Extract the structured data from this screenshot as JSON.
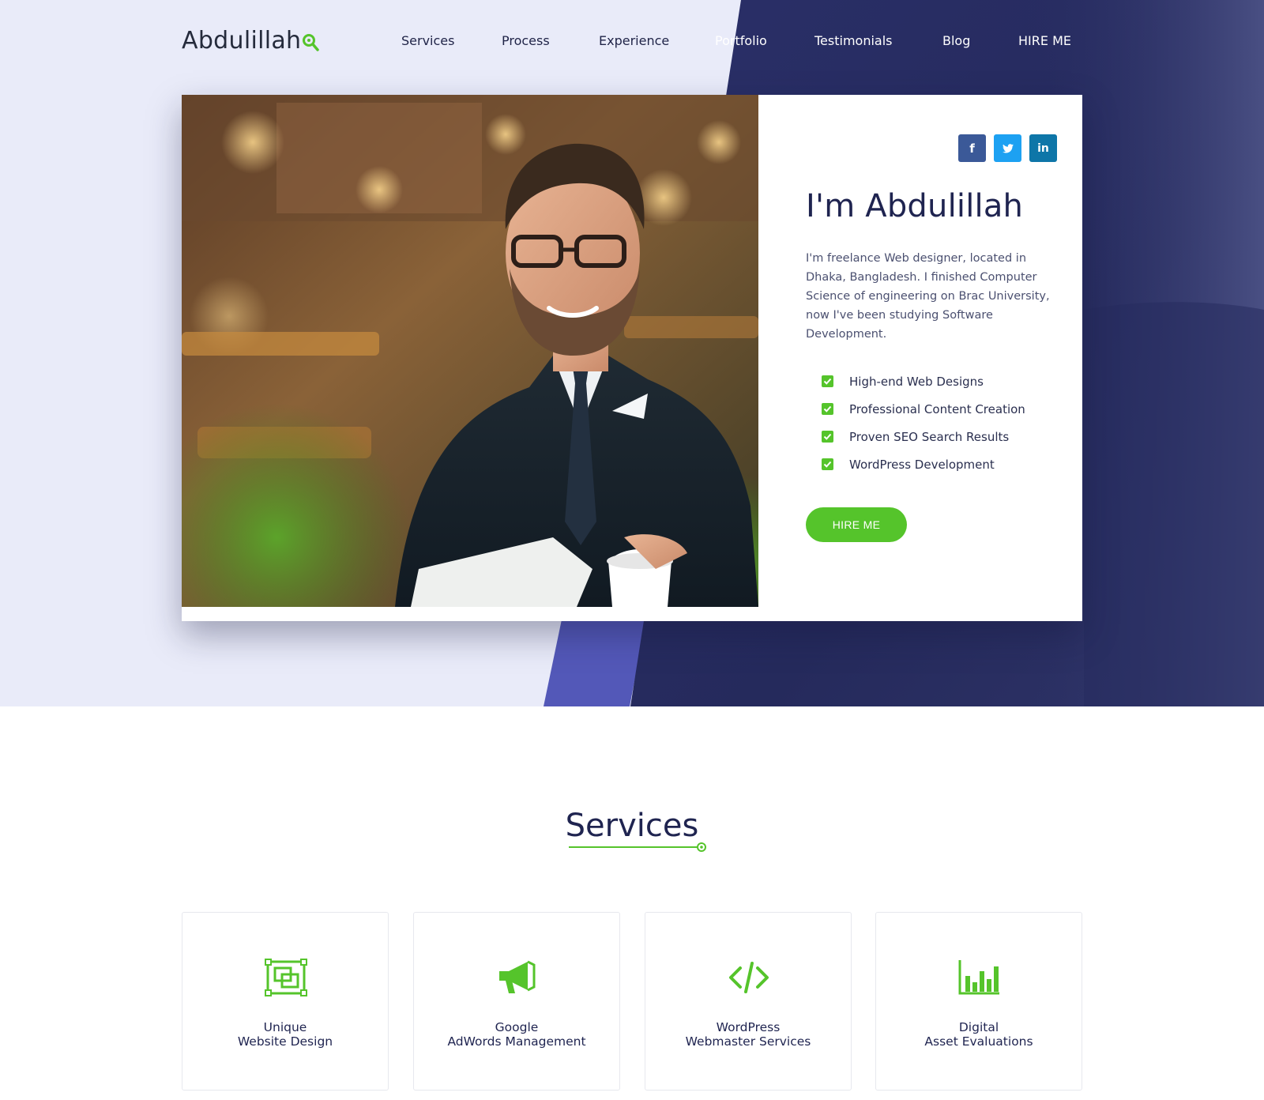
{
  "colors": {
    "accent_green": "#55c42b",
    "navy": "#272c5e",
    "hero_light_bg": "#e9ebf9",
    "stripe_purple": "#5358b8",
    "facebook": "#3b5998",
    "twitter": "#1da1f2",
    "linkedin": "#0e76a8"
  },
  "header": {
    "logo": "Abdulillah",
    "nav": [
      "Services",
      "Process",
      "Experience",
      "Portfolio",
      "Testimonials",
      "Blog",
      "HIRE ME"
    ]
  },
  "hero": {
    "social": [
      {
        "label": "f",
        "icon": "facebook-icon"
      },
      {
        "label": "t",
        "icon": "twitter-icon"
      },
      {
        "label": "in",
        "icon": "linkedin-icon"
      }
    ],
    "title": "I'm Abdulillah",
    "description": "I'm freelance Web designer, located in Dhaka, Bangladesh. I finished Computer Science of engineering on Brac University, now I've been studying Software Development.",
    "features": [
      "High-end Web Designs",
      "Professional Content Creation",
      "Proven SEO Search Results",
      "WordPress Development"
    ],
    "cta": "HIRE ME"
  },
  "services": {
    "title": "Services",
    "items": [
      {
        "line1": "Unique",
        "line2": "Website Design",
        "icon": "website-design-icon"
      },
      {
        "line1": "Google",
        "line2": "AdWords Management",
        "icon": "megaphone-icon"
      },
      {
        "line1": "WordPress",
        "line2": "Webmaster Services",
        "icon": "code-icon"
      },
      {
        "line1": "Digital",
        "line2": "Asset Evaluations",
        "icon": "bar-chart-icon"
      }
    ]
  }
}
